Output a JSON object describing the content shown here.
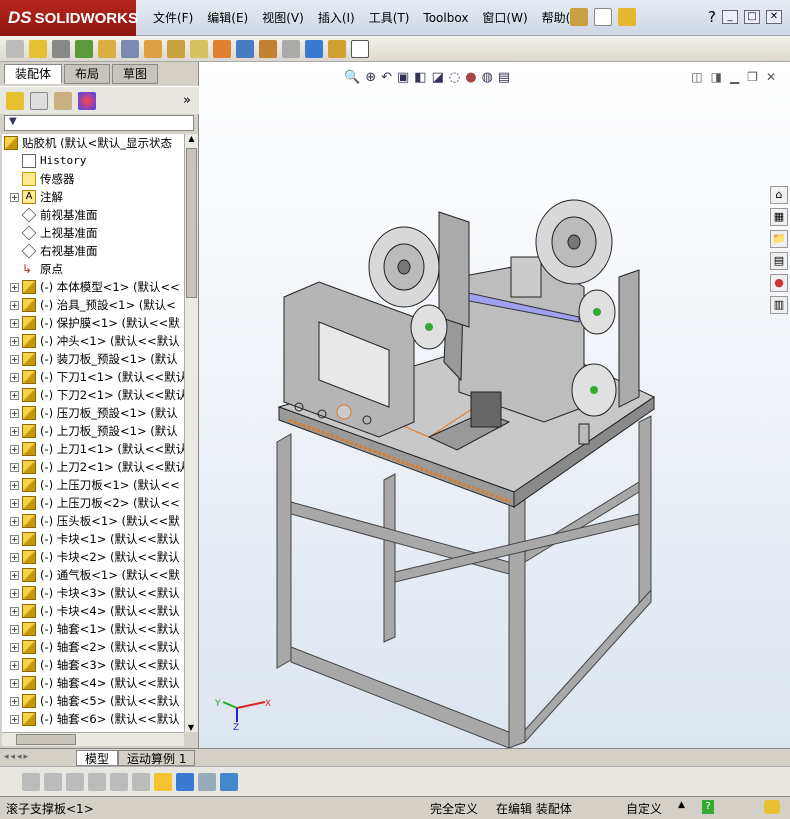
{
  "app": {
    "brand": "SOLIDWORKS",
    "brand_prefix": "DS"
  },
  "menu": [
    "文件(F)",
    "编辑(E)",
    "视图(V)",
    "插入(I)",
    "工具(T)",
    "Toolbox",
    "窗口(W)",
    "帮助(H)"
  ],
  "panel_tabs": [
    "装配体",
    "布局",
    "草图"
  ],
  "tree": {
    "root": "贴胶机  (默认<默认_显示状态",
    "fixed_items": [
      "History",
      "传感器",
      "注解",
      "前视基准面",
      "上视基准面",
      "右视基准面",
      "原点"
    ],
    "components": [
      "(-) 本体模型<1> (默认<<",
      "(-) 治具_预設<1> (默认<",
      "(-) 保护膜<1> (默认<<默",
      "(-) 冲头<1> (默认<<默认",
      "(-) 装刀板_预設<1> (默认",
      "(-) 下刀1<1> (默认<<默认",
      "(-) 下刀2<1> (默认<<默认",
      "(-) 压刀板_预設<1> (默认",
      "(-) 上刀板_预設<1> (默认",
      "(-) 上刀1<1> (默认<<默认",
      "(-) 上刀2<1> (默认<<默认",
      "(-) 上压刀板<1> (默认<<",
      "(-) 上压刀板<2> (默认<<",
      "(-) 压头板<1> (默认<<默",
      "(-) 卡块<1> (默认<<默认",
      "(-) 卡块<2> (默认<<默认",
      "(-) 通气板<1> (默认<<默",
      "(-) 卡块<3> (默认<<默认",
      "(-) 卡块<4> (默认<<默认",
      "(-) 轴套<1> (默认<<默认",
      "(-) 轴套<2> (默认<<默认",
      "(-) 轴套<3> (默认<<默认",
      "(-) 轴套<4> (默认<<默认",
      "(-) 轴套<5> (默认<<默认",
      "(-) 轴套<6> (默认<<默认"
    ]
  },
  "bottom_tabs": [
    "模型",
    "运动算例 1"
  ],
  "status": {
    "selection": "滚子支撑板<1>",
    "definition": "完全定义",
    "mode": "在编辑 装配体",
    "units": "自定义"
  },
  "triad": {
    "x": "X",
    "y": "Y",
    "z": "Z"
  },
  "colors": {
    "brand_red": "#b8261f",
    "accent_orange": "#e07a20",
    "frame_gray": "#9a9a9a"
  }
}
